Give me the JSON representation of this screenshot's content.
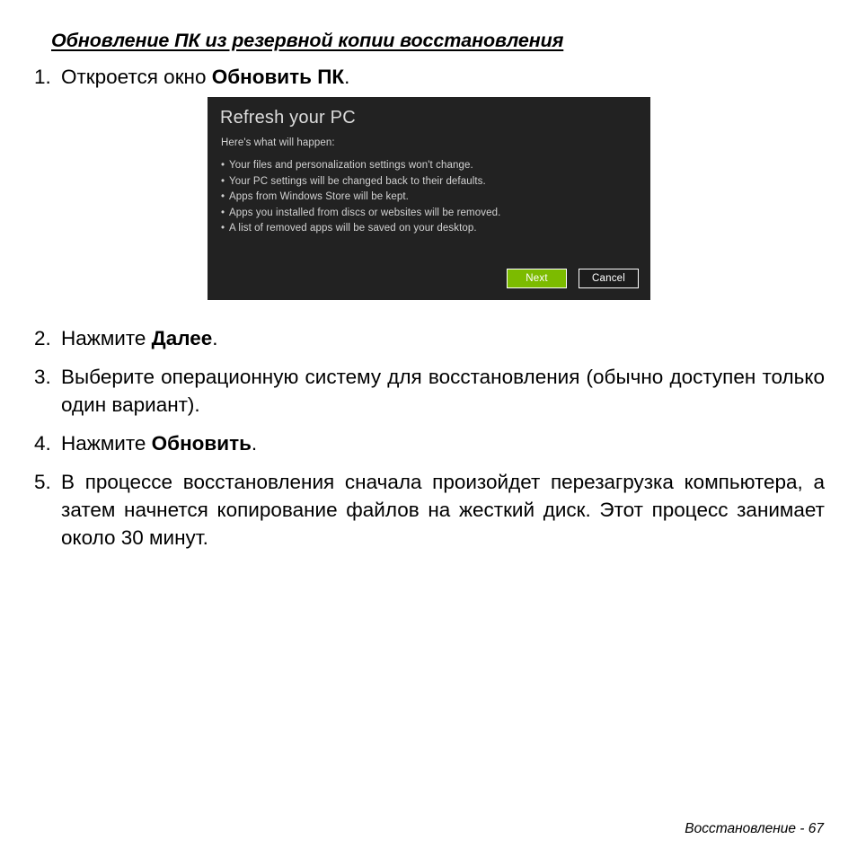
{
  "document": {
    "heading": "Обновление ПК из резервной копии восстановления",
    "footer": "Восстановление -  67"
  },
  "steps": [
    {
      "number": "1.",
      "text_before": "Откроется окно ",
      "bold": "Обновить ПК",
      "text_after": "."
    },
    {
      "number": "2.",
      "text_before": "Нажмите ",
      "bold": "Далее",
      "text_after": "."
    },
    {
      "number": "3.",
      "text_before": "Выберите операционную систему для восстановления (обычно доступен только один вариант).",
      "bold": "",
      "text_after": ""
    },
    {
      "number": "4.",
      "text_before": "Нажмите ",
      "bold": "Обновить",
      "text_after": "."
    },
    {
      "number": "5.",
      "text_before": "В процессе восстановления сначала произойдет перезагрузка компьютера, а затем начнется копирование файлов на жесткий диск. Этот процесс занимает около 30 минут.",
      "bold": "",
      "text_after": ""
    }
  ],
  "dialog": {
    "title": "Refresh your PC",
    "subtitle": "Here's what will happen:",
    "bullets": [
      "Your files and personalization settings won't change.",
      "Your PC settings will be changed back to their defaults.",
      "Apps from Windows Store will be kept.",
      "Apps you installed from discs or websites will be removed.",
      "A list of removed apps will be saved on your desktop."
    ],
    "bullet_marker": "•",
    "next_label": "Next",
    "cancel_label": "Cancel",
    "background_color": "#222222",
    "accent_color": "#7cbb00",
    "text_color": "#d2d2d2"
  }
}
